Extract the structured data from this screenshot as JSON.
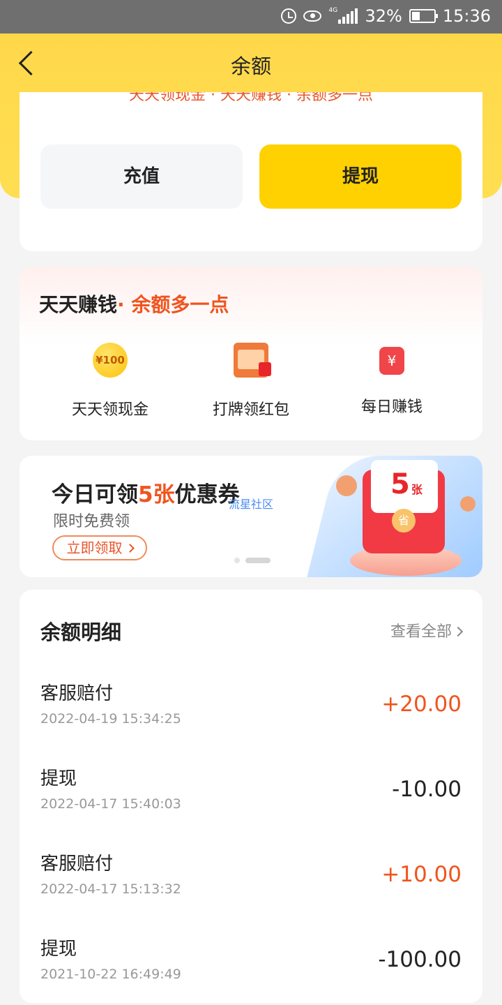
{
  "status_bar": {
    "battery": "32%",
    "time": "15:36",
    "network": "4G"
  },
  "nav": {
    "title": "余额"
  },
  "balance": {
    "cut_text": "天天领现金 · 天天赚钱 · 余额多一点",
    "recharge_label": "充值",
    "withdraw_label": "提现"
  },
  "earn": {
    "title": "天天赚钱",
    "subtitle": "· 余额多一点",
    "items": [
      {
        "label": "天天领现金",
        "icon": "coin-100-icon",
        "icon_text": "¥100"
      },
      {
        "label": "打牌领红包",
        "icon": "cards-redpacket-icon"
      },
      {
        "label": "每日赚钱",
        "icon": "calendar-money-icon",
        "icon_text": "¥"
      }
    ]
  },
  "banner": {
    "title_prefix": "今日可领",
    "title_highlight": "5张",
    "title_suffix": "优惠券",
    "subtitle": "限时免费领",
    "claim_label": "立即领取",
    "watermark": "流星社区",
    "art_number": "5",
    "art_unit": "张",
    "art_seal": "省"
  },
  "details": {
    "title": "余额明细",
    "view_all": "查看全部",
    "rows": [
      {
        "name": "客服赔付",
        "time": "2022-04-19 15:34:25",
        "amount": "+20.00",
        "positive": true
      },
      {
        "name": "提现",
        "time": "2022-04-17 15:40:03",
        "amount": "-10.00",
        "positive": false
      },
      {
        "name": "客服赔付",
        "time": "2022-04-17 15:13:32",
        "amount": "+10.00",
        "positive": true
      },
      {
        "name": "提现",
        "time": "2021-10-22 16:49:49",
        "amount": "-100.00",
        "positive": false
      }
    ]
  },
  "colors": {
    "brand_yellow": "#ffd100",
    "accent_orange": "#f0541e"
  }
}
